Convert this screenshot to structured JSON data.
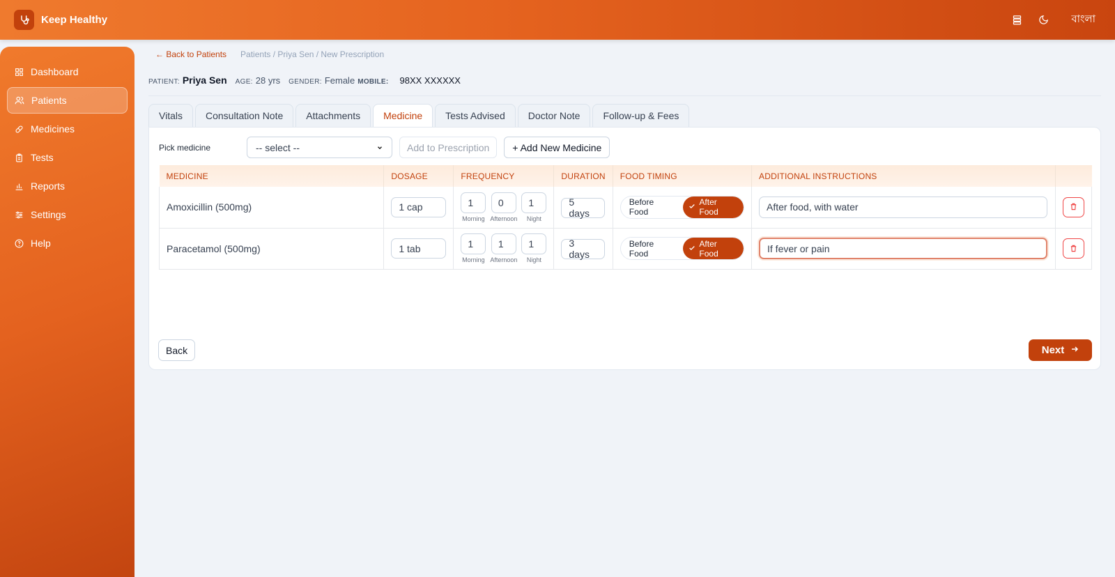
{
  "app": {
    "name": "Keep Healthy",
    "language_toggle": "বাংলা"
  },
  "sidebar": {
    "items": [
      {
        "label": "Dashboard",
        "icon": "grid-icon",
        "active": false
      },
      {
        "label": "Patients",
        "icon": "users-icon",
        "active": true
      },
      {
        "label": "Medicines",
        "icon": "pill-icon",
        "active": false
      },
      {
        "label": "Tests",
        "icon": "clipboard-icon",
        "active": false
      },
      {
        "label": "Reports",
        "icon": "bar-chart-icon",
        "active": false
      },
      {
        "label": "Settings",
        "icon": "sliders-icon",
        "active": false
      },
      {
        "label": "Help",
        "icon": "help-circle-icon",
        "active": false
      }
    ]
  },
  "breadcrumb": {
    "back": "← Back to Patients",
    "path": "Patients / Priya Sen / New Prescription"
  },
  "patient": {
    "label": "PATIENT:",
    "name": "Priya Sen",
    "age_label": "AGE:",
    "age": "28 yrs",
    "gender_label": "GENDER:",
    "gender": "Female",
    "mobile_label": "MOBILE:",
    "mobile": "98XX XXXXXX"
  },
  "tabs": [
    "Vitals",
    "Consultation Note",
    "Attachments",
    "Medicine",
    "Tests Advised",
    "Doctor Note",
    "Follow-up & Fees"
  ],
  "active_tab": "Medicine",
  "picker": {
    "label": "Pick medicine",
    "select_value": "-- select --",
    "add_button": "Add to Prescription",
    "new_button": "+ Add New Medicine"
  },
  "table": {
    "headers": [
      "MEDICINE",
      "DOSAGE",
      "FREQUENCY",
      "DURATION",
      "FOOD TIMING",
      "ADDITIONAL INSTRUCTIONS"
    ],
    "freq_labels": [
      "Morning",
      "Afternoon",
      "Night"
    ],
    "food_options": [
      "Before Food",
      "After Food"
    ],
    "rows": [
      {
        "medicine": "Amoxicillin (500mg)",
        "dosage": "1 cap",
        "morning": "1",
        "afternoon": "0",
        "night": "1",
        "duration": "5 days",
        "food": "After Food",
        "instructions": "After food, with water"
      },
      {
        "medicine": "Paracetamol (500mg)",
        "dosage": "1 tab",
        "morning": "1",
        "afternoon": "1",
        "night": "1",
        "duration": "3 days",
        "food": "After Food",
        "instructions": "If fever or pain"
      }
    ]
  },
  "footer": {
    "back": "Back",
    "next": "Next"
  },
  "colors": {
    "accent": "#c2410c",
    "header_gradient_start": "#ef7a2e",
    "background": "#f0f3f8"
  }
}
